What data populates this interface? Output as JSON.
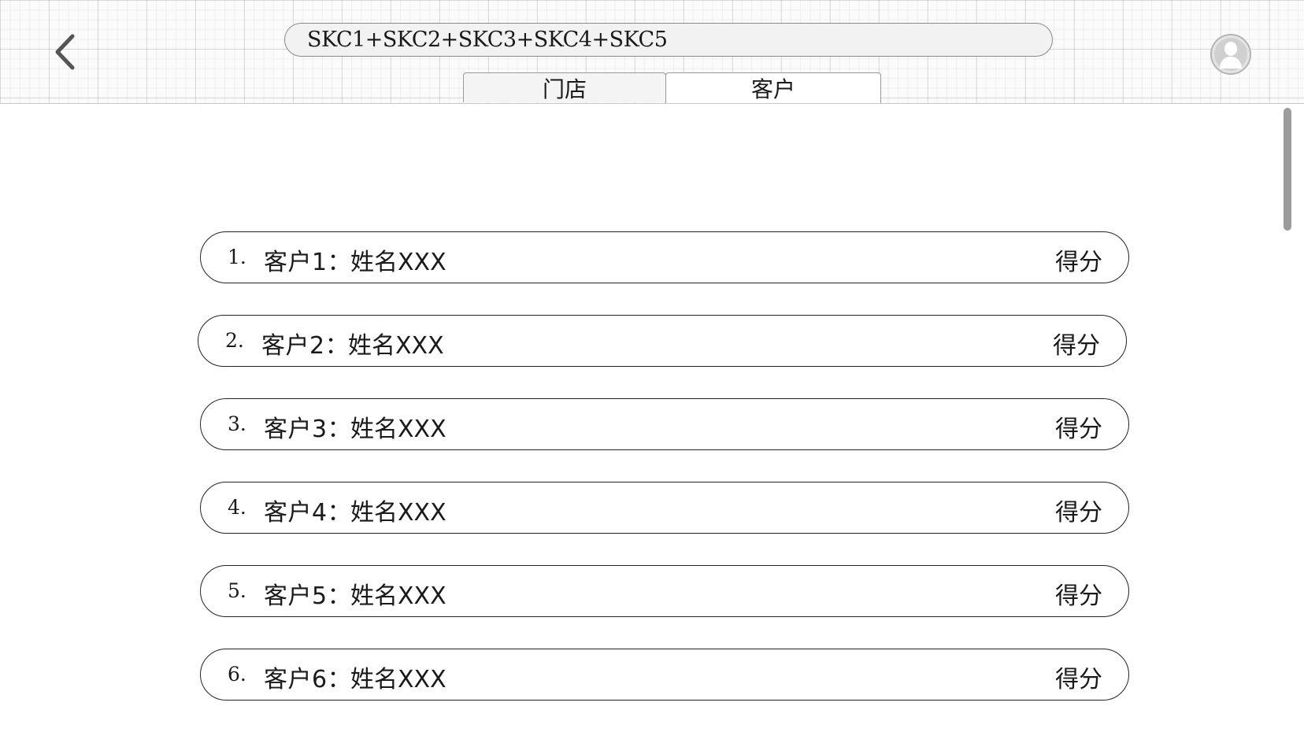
{
  "header": {
    "search_value": "SKC1+SKC2+SKC3+SKC4+SKC5",
    "back_icon": "chevron-left-icon",
    "avatar_icon": "user-avatar-icon"
  },
  "tabs": [
    {
      "label": "门店",
      "active": false
    },
    {
      "label": "客户",
      "active": true
    }
  ],
  "customers": [
    {
      "index": "1.",
      "label": "客户1：",
      "name": "姓名XXX",
      "score": "得分"
    },
    {
      "index": "2.",
      "label": "客户2：",
      "name": "姓名XXX",
      "score": "得分"
    },
    {
      "index": "3.",
      "label": "客户3：",
      "name": "姓名XXX",
      "score": "得分"
    },
    {
      "index": "4.",
      "label": "客户4：",
      "name": "姓名XXX",
      "score": "得分"
    },
    {
      "index": "5.",
      "label": "客户5：",
      "name": "姓名XXX",
      "score": "得分"
    },
    {
      "index": "6.",
      "label": "客户6：",
      "name": "姓名XXX",
      "score": "得分"
    }
  ],
  "colors": {
    "border": "#222222",
    "search_bg": "#f2f2f2",
    "scrollbar": "#9c9c9c"
  }
}
